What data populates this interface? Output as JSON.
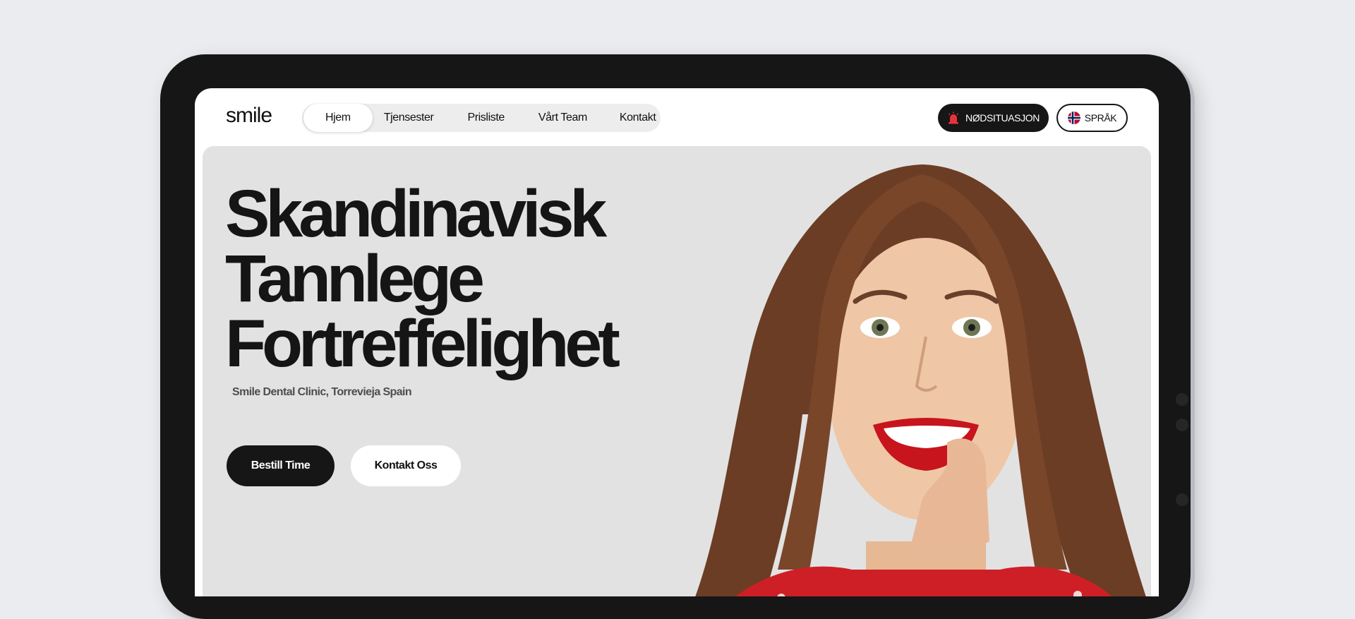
{
  "header": {
    "logo": "smile",
    "nav": [
      {
        "label": "Hjem",
        "active": true
      },
      {
        "label": "Tjensester",
        "active": false
      },
      {
        "label": "Prisliste",
        "active": false
      },
      {
        "label": "Vårt Team",
        "active": false
      },
      {
        "label": "Kontakt",
        "active": false
      }
    ],
    "emergency_label": "NØDSITUASJON",
    "emergency_icon": "siren-icon",
    "language_label": "SPRÅK",
    "language_icon": "norway-flag-icon"
  },
  "hero": {
    "headline_lines": [
      "Skandinavisk",
      "Tannlege",
      "Fortreffelighet"
    ],
    "subtitle": "Smile Dental Clinic, Torrevieja Spain",
    "primary_cta": "Bestill Time",
    "secondary_cta": "Kontakt Oss",
    "image": "smiling-woman-portrait"
  },
  "colors": {
    "dark": "#161616",
    "hero_background": "#e2e2e2",
    "page_background": "#ebecef",
    "siren_red": "#e8323a",
    "lips_red": "#c8141c"
  }
}
